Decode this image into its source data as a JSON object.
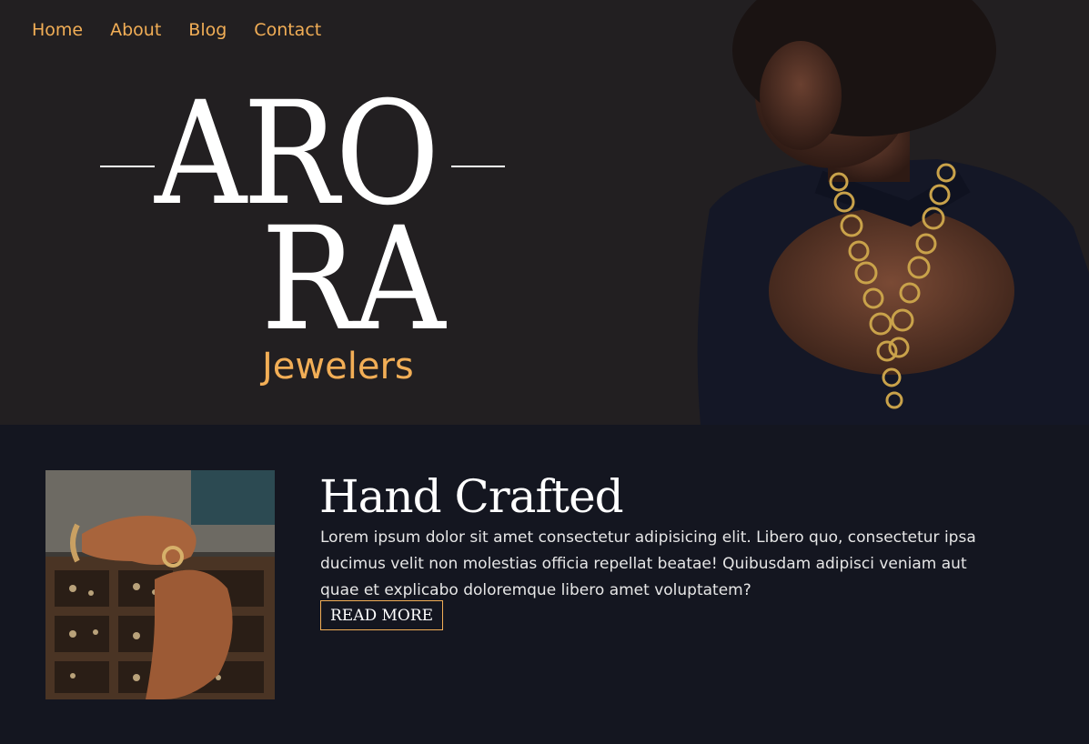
{
  "nav": {
    "items": [
      {
        "label": "Home"
      },
      {
        "label": "About"
      },
      {
        "label": "Blog"
      },
      {
        "label": "Contact"
      }
    ]
  },
  "hero": {
    "logo_line1": "ARO",
    "logo_line2": "RA",
    "logo_sub": "Jewelers"
  },
  "feature": {
    "title": "Hand Crafted",
    "text": "Lorem ipsum dolor sit amet consectetur adipisicing elit. Libero quo, consectetur ipsa ducimus velit non molestias officia repellat beatae! Quibusdam adipisci veniam aut quae et explicabo doloremque libero amet voluptatem?",
    "button_label": "READ MORE"
  },
  "colors": {
    "accent": "#f2ae56",
    "hero_bg": "#221f21",
    "section_bg": "#141620"
  }
}
